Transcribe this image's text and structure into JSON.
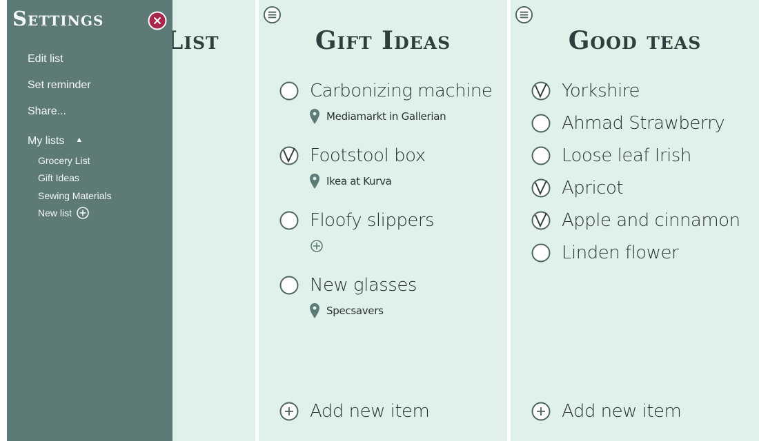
{
  "colors": {
    "panel_bg": "#e0f1ea",
    "drawer_bg": "#5e7a77",
    "text_dark": "#253331",
    "close_accent": "#a8274a"
  },
  "panel1": {
    "title": "List"
  },
  "panel2": {
    "title": "Gift Ideas",
    "items": [
      {
        "text": "Carbonizing machine",
        "checked": false,
        "location": "Mediamarkt in Gallerian"
      },
      {
        "text": "Footstool box",
        "checked": true,
        "location": "Ikea at Kurva"
      },
      {
        "text": "Floofy slippers",
        "checked": false,
        "location": ""
      },
      {
        "text": "New glasses",
        "checked": false,
        "location": "Specsavers"
      }
    ],
    "add_label": "Add new item"
  },
  "panel3": {
    "title": "Good teas",
    "items": [
      {
        "text": "Yorkshire",
        "checked": true
      },
      {
        "text": "Ahmad Strawberry",
        "checked": false
      },
      {
        "text": "Loose leaf Irish",
        "checked": false
      },
      {
        "text": "Apricot",
        "checked": true
      },
      {
        "text": "Apple and cinnamon",
        "checked": true
      },
      {
        "text": "Linden flower",
        "checked": false
      }
    ],
    "add_label": "Add new item"
  },
  "settings": {
    "title": "Settings",
    "menu": {
      "edit": "Edit list",
      "reminder": "Set reminder",
      "share": "Share...",
      "mylists": "My lists",
      "caret": "▲"
    },
    "lists": [
      "Grocery List",
      "Gift Ideas",
      "Sewing Materials"
    ],
    "new_list": "New list"
  }
}
